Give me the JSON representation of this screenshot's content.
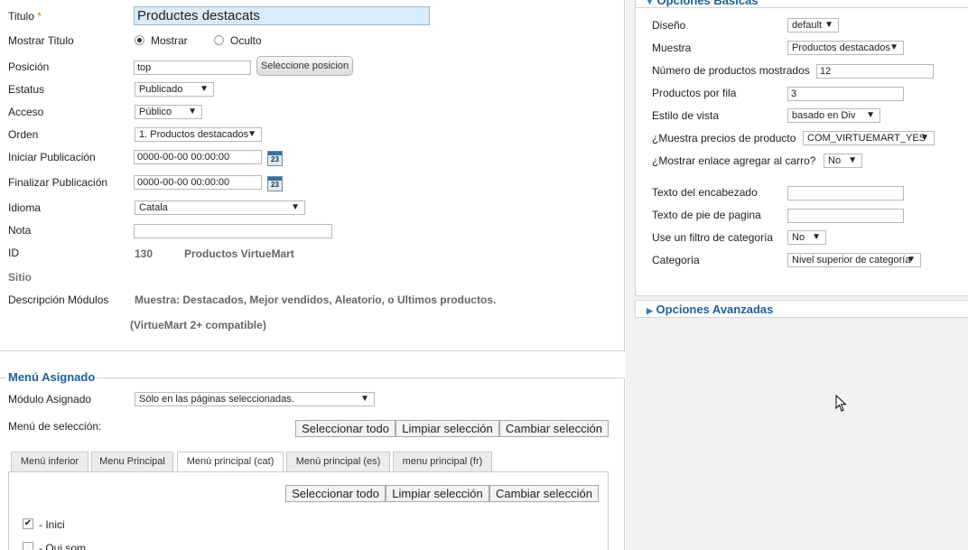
{
  "form": {
    "title_label": "Titulo",
    "title_required": "*",
    "title_value": "Productes destacats",
    "show_title_label": "Mostrar Titulo",
    "show_option": "Mostrar",
    "hide_option": "Oculto",
    "position_label": "Posición",
    "position_value": "top",
    "select_position_button": "Seleccione posicion",
    "status_label": "Estatus",
    "status_value": "Publicado",
    "access_label": "Acceso",
    "access_value": "Público",
    "order_label": "Orden",
    "order_value": "1. Productos destacados",
    "start_label": "Iniciar Publicación",
    "start_value": "0000-00-00 00:00:00",
    "end_label": "Finalizar Publicación",
    "end_value": "0000-00-00 00:00:00",
    "calendar_glyph": "23",
    "language_label": "Idioma",
    "language_value": "Catala",
    "note_label": "Nota",
    "note_value": "",
    "id_label": "ID",
    "id_value": "130",
    "module_type": "Productos VirtueMart",
    "site_label": "Sitio",
    "desc_label": "Descripción Módulos",
    "desc_value": "Muestra: Destacados, Mejor vendidos, Aleatorio, o Ultimos productos.",
    "desc_compat": "(VirtueMart 2+ compatible)"
  },
  "menu": {
    "legend": "Menú Asignado",
    "assigned_label": "Módulo Asignado",
    "assigned_value": "Sólo en las páginas seleccionadas.",
    "selection_label": "Menú de selección:",
    "btn_select_all": "Seleccionar todo",
    "btn_clear": "Limpiar selección",
    "btn_toggle": "Cambiar selección",
    "tabs": [
      "Menú inferior",
      "Menu Principal",
      "Menú principal (cat)",
      "Menú principal (es)",
      "menu principal (fr)"
    ],
    "active_tab": "Menú principal (cat)",
    "items": [
      {
        "label": "- Inici",
        "checked": true
      },
      {
        "label": "- Qui som",
        "checked": false
      }
    ]
  },
  "basic": {
    "title": "Opciones Basicas",
    "layout_label": "Diseño",
    "layout_value": "default",
    "show_label": "Muestra",
    "show_value": "Productos destacados",
    "count_label": "Número de productos mostrados",
    "count_value": "12",
    "per_row_label": "Productos por fila",
    "per_row_value": "3",
    "style_label": "Estilo de vista",
    "style_value": "basado en Div",
    "prices_label": "¿Muestra precios de producto",
    "prices_value": "COM_VIRTUEMART_YES",
    "cart_label": "¿Mostrar enlace agregar al carro?",
    "cart_value": "No",
    "header_label": "Texto del encabezado",
    "header_value": "",
    "footer_label": "Texto de pie de pagina",
    "footer_value": "",
    "filter_label": "Use un filtro de categoría",
    "filter_value": "No",
    "category_label": "Categoría",
    "category_value": "Nivel superior de categoría"
  },
  "advanced": {
    "title": "Opciones Avanzadas"
  },
  "icons": {
    "dropdown": "chevron-down-icon",
    "expand": "triangle-right-icon",
    "collapse": "triangle-down-icon",
    "calendar": "calendar-icon",
    "cursor": "mouse-pointer-icon"
  },
  "colors": {
    "section_title": "#1e5f94",
    "required_star": "#e8742a",
    "highlight_input": "#d9ebf9"
  }
}
